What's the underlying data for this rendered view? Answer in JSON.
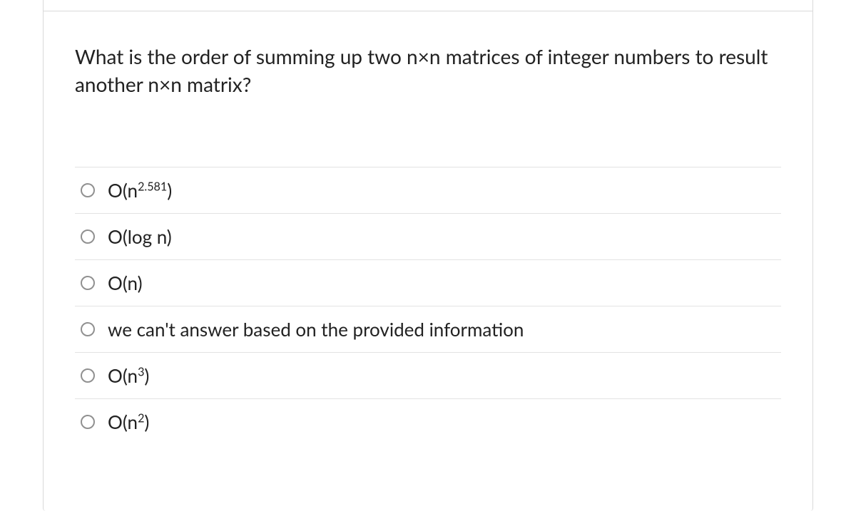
{
  "question": "What is the order of summing up two n×n matrices of integer numbers to result another n×n matrix?",
  "options": [
    {
      "pre": "O(n",
      "sup": "2.581",
      "post": ")"
    },
    {
      "pre": "O(log n)",
      "sup": "",
      "post": ""
    },
    {
      "pre": "O(n)",
      "sup": "",
      "post": ""
    },
    {
      "pre": "we can't answer based on the provided information",
      "sup": "",
      "post": ""
    },
    {
      "pre": "O(n",
      "sup": "3",
      "post": ")"
    },
    {
      "pre": "O(n",
      "sup": "2",
      "post": ")"
    }
  ]
}
